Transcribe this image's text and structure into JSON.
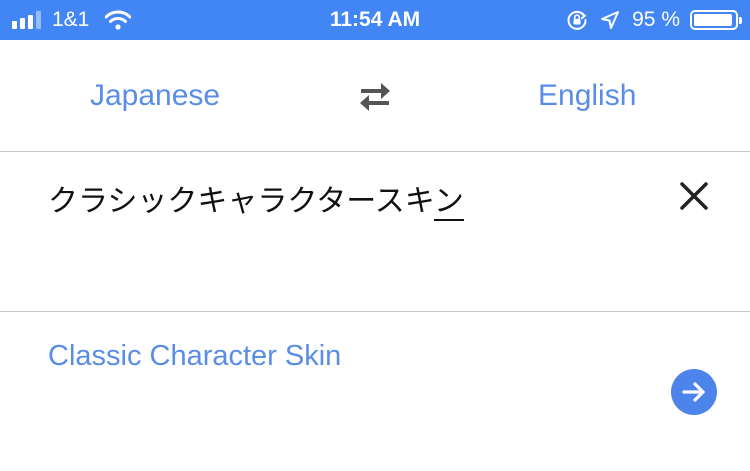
{
  "status_bar": {
    "carrier": "1&1",
    "time": "11:54 AM",
    "battery_percent": "95 %",
    "battery_level": 0.95,
    "signal_bars": 3,
    "icons": [
      "signal-icon",
      "wifi-icon",
      "rotation-lock-icon",
      "location-arrow-icon",
      "battery-icon"
    ]
  },
  "languages": {
    "source": "Japanese",
    "target": "English",
    "swap_icon": "swap-arrows-icon"
  },
  "input": {
    "committed": "クラシックキャラクタースキ",
    "composing": "ン",
    "clear_icon": "close-icon"
  },
  "translation": {
    "text": "Classic Character Skin",
    "action_icon": "arrow-right-icon"
  },
  "colors": {
    "status_bar": "#4285f4",
    "link_blue": "#5a8ee6",
    "button_blue": "#4c84ec",
    "divider": "#c8c8c8"
  }
}
